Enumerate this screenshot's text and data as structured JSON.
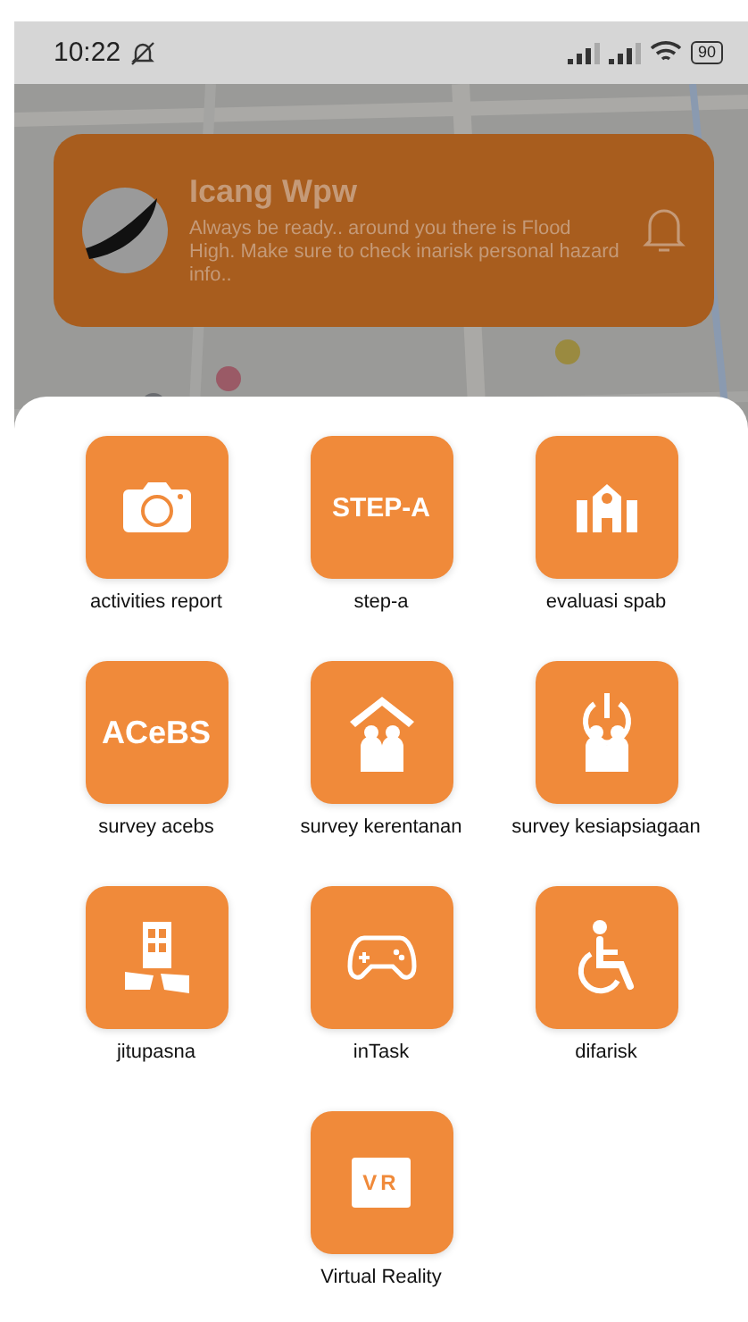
{
  "status_bar": {
    "time": "10:22",
    "battery": "90"
  },
  "notification": {
    "title": "Icang Wpw",
    "message": "Always be ready.. around you there is Flood High. Make sure to check inarisk personal hazard info.."
  },
  "menu": [
    {
      "label": "activities report",
      "kind": "camera"
    },
    {
      "label": "step-a",
      "kind": "text",
      "glyph": "STEP-A"
    },
    {
      "label": "evaluasi spab",
      "kind": "school"
    },
    {
      "label": "survey acebs",
      "kind": "text",
      "glyph": "ACeBS"
    },
    {
      "label": "survey kerentanan",
      "kind": "family-house"
    },
    {
      "label": "survey kesiapsiagaan",
      "kind": "family-power"
    },
    {
      "label": "jitupasna",
      "kind": "building-broken"
    },
    {
      "label": "inTask",
      "kind": "gamepad"
    },
    {
      "label": "difarisk",
      "kind": "wheelchair"
    },
    {
      "label": "Virtual Reality",
      "kind": "badge",
      "glyph": "VR"
    }
  ]
}
